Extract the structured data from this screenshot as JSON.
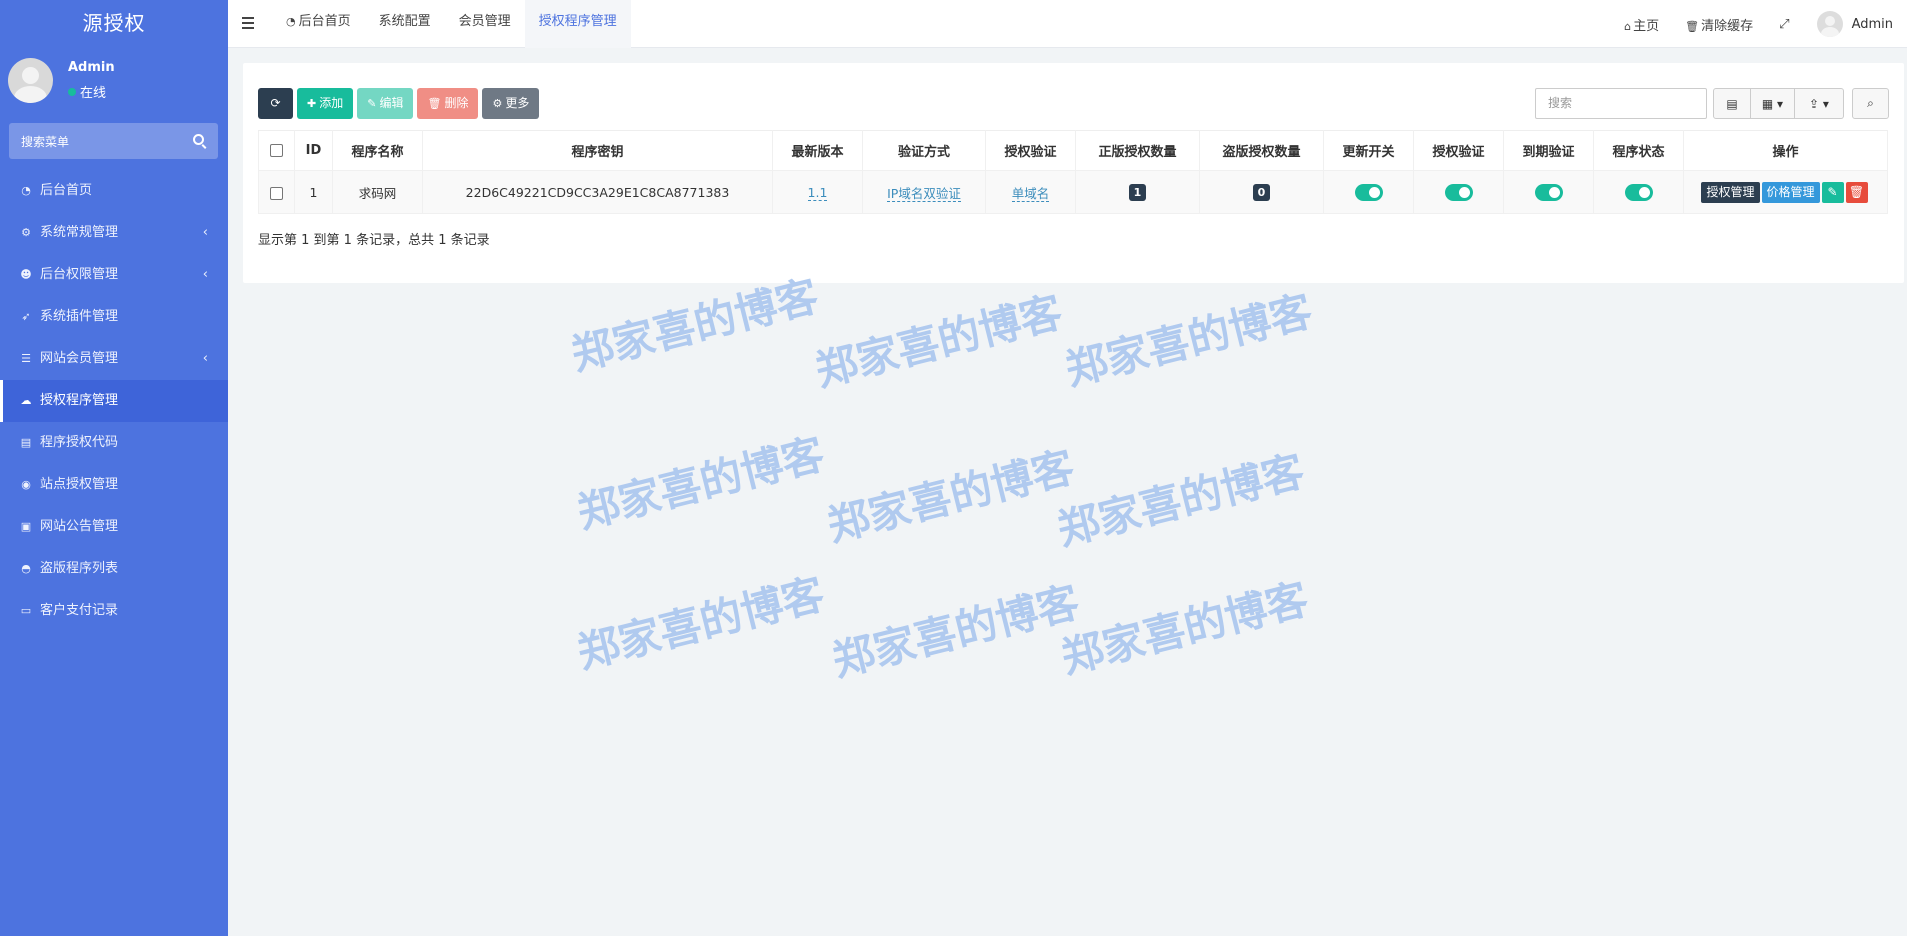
{
  "brand": "源授权",
  "user": {
    "name": "Admin",
    "status": "在线"
  },
  "sidebar": {
    "search_placeholder": "搜索菜单",
    "items": [
      {
        "label": "后台首页",
        "icon": "dashboard-icon",
        "glyph": "◔",
        "arrow": ""
      },
      {
        "label": "系统常规管理",
        "icon": "cogs-icon",
        "glyph": "⚙",
        "arrow": "‹"
      },
      {
        "label": "后台权限管理",
        "icon": "users-icon",
        "glyph": "☻",
        "arrow": "‹"
      },
      {
        "label": "系统插件管理",
        "icon": "rocket-icon",
        "glyph": "➶",
        "arrow": ""
      },
      {
        "label": "网站会员管理",
        "icon": "list-icon",
        "glyph": "☰",
        "arrow": "‹"
      },
      {
        "label": "授权程序管理",
        "icon": "cloud-icon",
        "glyph": "☁",
        "arrow": ""
      },
      {
        "label": "程序授权代码",
        "icon": "id-card-icon",
        "glyph": "▤",
        "arrow": ""
      },
      {
        "label": "站点授权管理",
        "icon": "ie-icon",
        "glyph": "◉",
        "arrow": ""
      },
      {
        "label": "网站公告管理",
        "icon": "square-icon",
        "glyph": "▣",
        "arrow": ""
      },
      {
        "label": "盗版程序列表",
        "icon": "shield-icon",
        "glyph": "◓",
        "arrow": ""
      },
      {
        "label": "客户支付记录",
        "icon": "credit-card-icon",
        "glyph": "▭",
        "arrow": ""
      }
    ]
  },
  "topbar": {
    "tabs": [
      {
        "label": "后台首页",
        "glyph": "◔"
      },
      {
        "label": "系统配置",
        "glyph": ""
      },
      {
        "label": "会员管理",
        "glyph": ""
      },
      {
        "label": "授权程序管理",
        "glyph": ""
      }
    ],
    "home": "主页",
    "clear_cache": "清除缓存",
    "admin": "Admin"
  },
  "toolbar": {
    "add": "添加",
    "edit": "编辑",
    "delete": "删除",
    "more": "更多",
    "search_placeholder": "搜索"
  },
  "table": {
    "headers": [
      "ID",
      "程序名称",
      "程序密钥",
      "最新版本",
      "验证方式",
      "授权验证",
      "正版授权数量",
      "盗版授权数量",
      "更新开关",
      "授权验证",
      "到期验证",
      "程序状态",
      "操作"
    ],
    "rows": [
      {
        "id": "1",
        "name": "求码网",
        "key": "22D6C49221CD9CC3A29E1C8CA8771383",
        "version": "1.1",
        "verify_method": "IP域名双验证",
        "auth_verify": "单域名",
        "genuine_count": "1",
        "pirate_count": "0",
        "update_switch": true,
        "auth_switch": true,
        "expire_switch": true,
        "status_switch": true,
        "op_auth": "授权管理",
        "op_price": "价格管理"
      }
    ]
  },
  "pager": "显示第 1 到第 1 条记录，总共 1 条记录",
  "watermark": "郑家喜的博客",
  "colors": {
    "sidebar": "#4d73df",
    "accent": "#18bc9c",
    "dark": "#2c3e50"
  }
}
